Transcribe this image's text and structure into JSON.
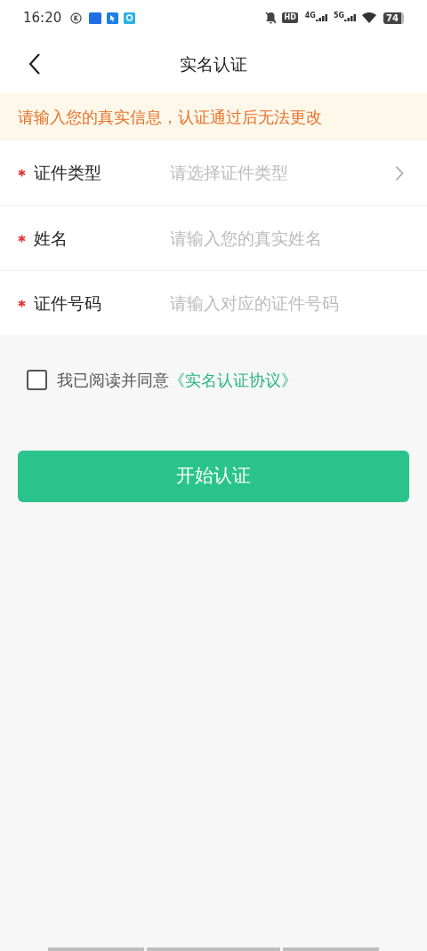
{
  "status_bar": {
    "time": "16:20",
    "hd": "HD",
    "network_1": "4G",
    "network_2": "5G",
    "battery": "74"
  },
  "header": {
    "title": "实名认证"
  },
  "notice": "请输入您的真实信息，认证通过后无法更改",
  "fields": [
    {
      "kind": "select",
      "required": true,
      "label": "证件类型",
      "placeholder": "请选择证件类型"
    },
    {
      "kind": "input",
      "required": true,
      "label": "姓名",
      "placeholder": "请输入您的真实姓名"
    },
    {
      "kind": "input",
      "required": true,
      "label": "证件号码",
      "placeholder": "请输入对应的证件号码"
    }
  ],
  "agreement": {
    "checked": false,
    "text": "我已阅读并同意",
    "link": "《实名认证协议》"
  },
  "submit": "开始认证"
}
